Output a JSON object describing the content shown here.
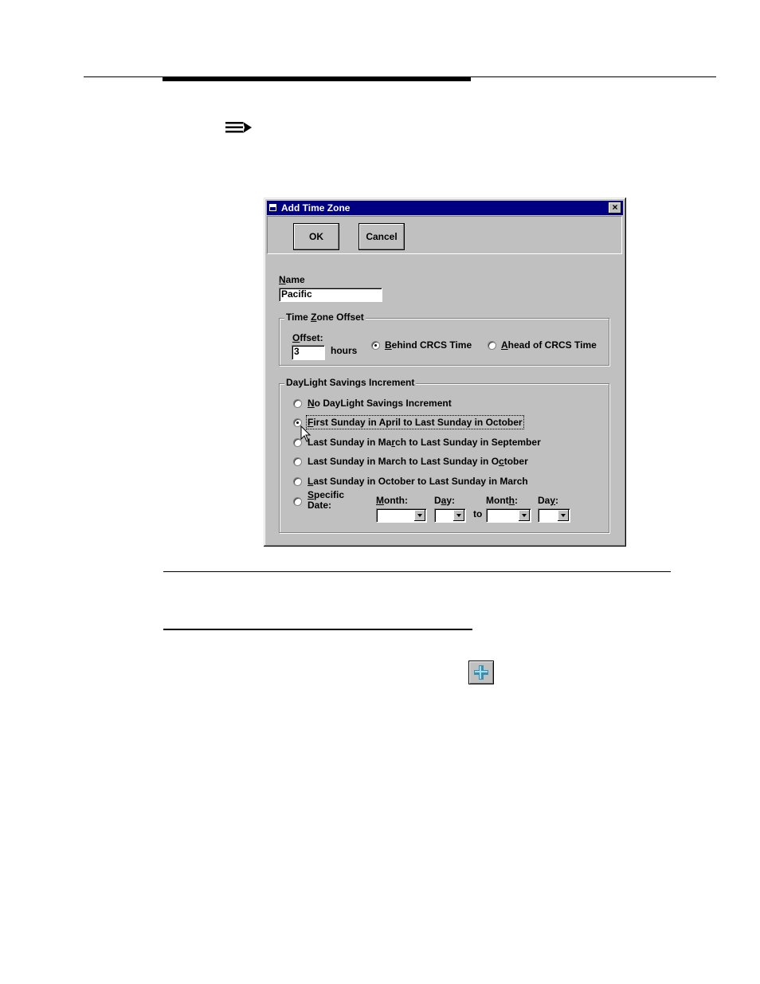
{
  "dialog": {
    "title": "Add Time Zone",
    "close_glyph": "×",
    "ok_label": "OK",
    "cancel_label": "Cancel"
  },
  "name_field": {
    "label_accel": "N",
    "label_rest": "ame",
    "value": "Pacific"
  },
  "offset_group": {
    "title_pre": "Time ",
    "title_accel": "Z",
    "title_post": "one Offset",
    "offset_label_accel": "O",
    "offset_label_rest": "ffset:",
    "offset_value": "3",
    "hours_label": "hours",
    "behind_accel": "B",
    "behind_rest": "ehind CRCS Time",
    "ahead_accel": "A",
    "ahead_rest": "head of CRCS Time",
    "selected": "behind"
  },
  "dst_group": {
    "title": "DayLight Savings Increment",
    "options": [
      {
        "pre": "",
        "accel": "N",
        "post": "o DayLight Savings Increment"
      },
      {
        "pre": "",
        "accel": "F",
        "post": "irst Sunday in April to Last Sunday in October"
      },
      {
        "pre": "Last Sunday in Ma",
        "accel": "r",
        "post": "ch to Last Sunday in September"
      },
      {
        "pre": "Last Sunday in March to Last Sunday in O",
        "accel": "c",
        "post": "tober"
      },
      {
        "pre": "",
        "accel": "L",
        "post": "ast Sunday in October to Last Sunday in March"
      }
    ],
    "selected_index": 1,
    "specific": {
      "accel": "S",
      "line1_rest": "pecific",
      "line2": "Date:",
      "month1_label": "Month:",
      "month1_accel": "M",
      "day1_pre": "D",
      "day1_accel": "a",
      "day1_post": "y:",
      "to_label": "to",
      "month2_pre": "Mont",
      "month2_accel": "h",
      "month2_post": ":",
      "day2_pre": "Da",
      "day2_accel": "y",
      "day2_post": ":"
    }
  },
  "icons": {
    "note": "note-arrow-icon",
    "add": "add-plus-icon"
  }
}
